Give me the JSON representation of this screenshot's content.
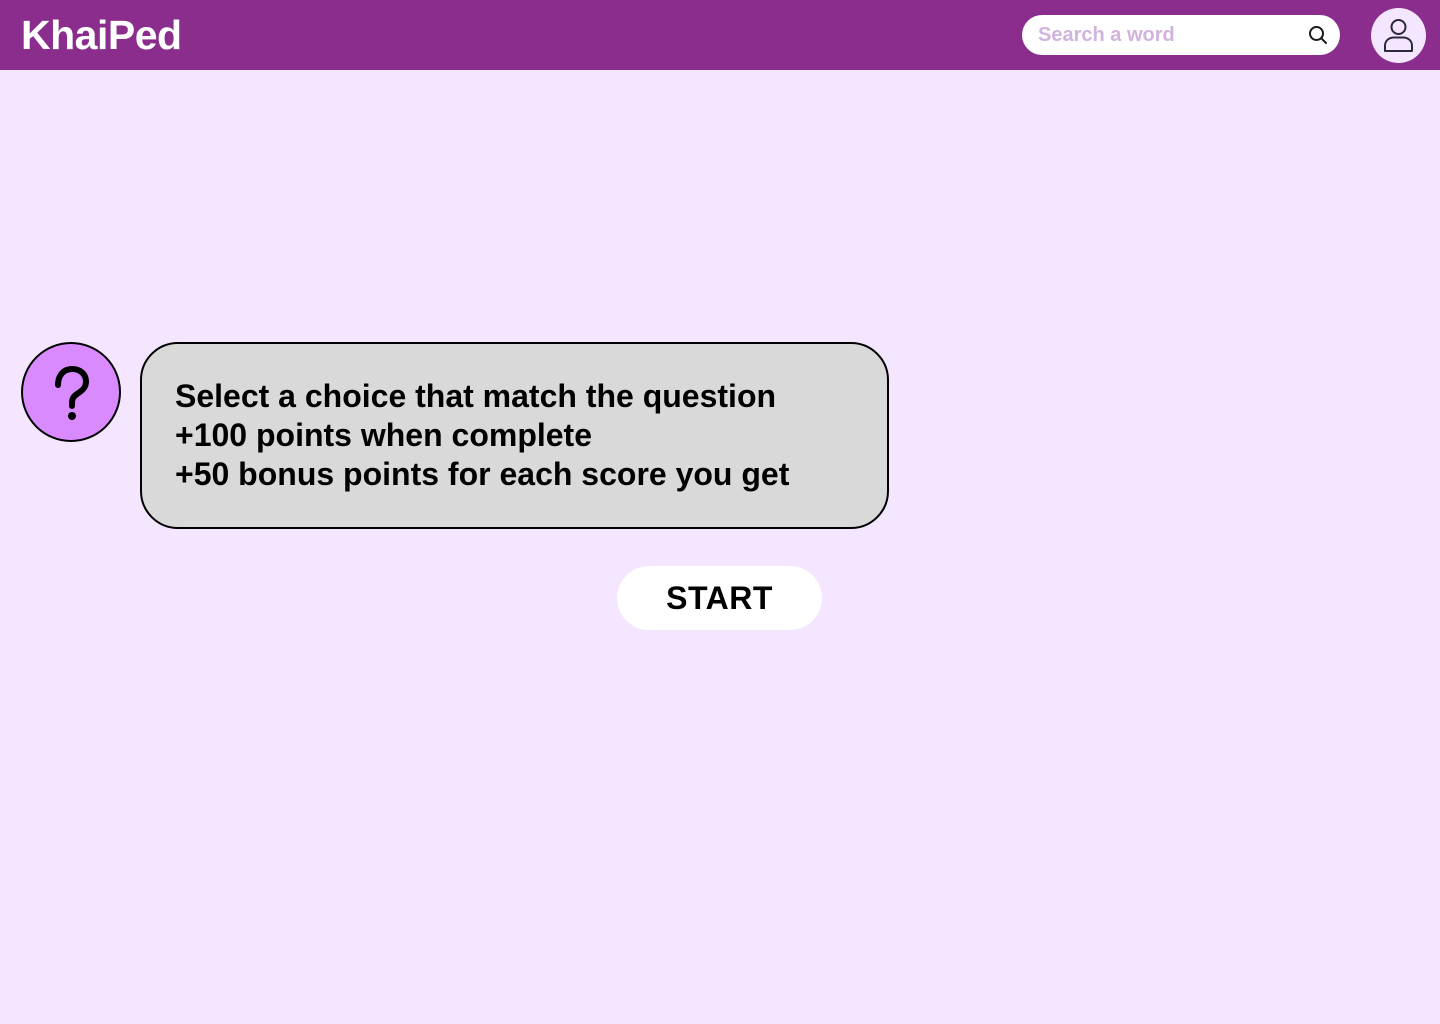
{
  "header": {
    "logo": "KhaiPed",
    "search": {
      "placeholder": "Search a word",
      "value": "",
      "icon": "search-icon"
    },
    "avatar_icon": "user-icon"
  },
  "instructions": {
    "icon": "question-mark-icon",
    "lines": [
      "Select a choice that match the question",
      "+100 points when complete",
      "+50 bonus points for each score you get"
    ]
  },
  "actions": {
    "start_label": "START"
  },
  "colors": {
    "header_bg": "#8A2D8C",
    "page_bg": "#F5E6FF",
    "bubble_bg": "#D9D9D9",
    "icon_bg": "#DA8AFF",
    "placeholder": "#D1B3DD"
  }
}
